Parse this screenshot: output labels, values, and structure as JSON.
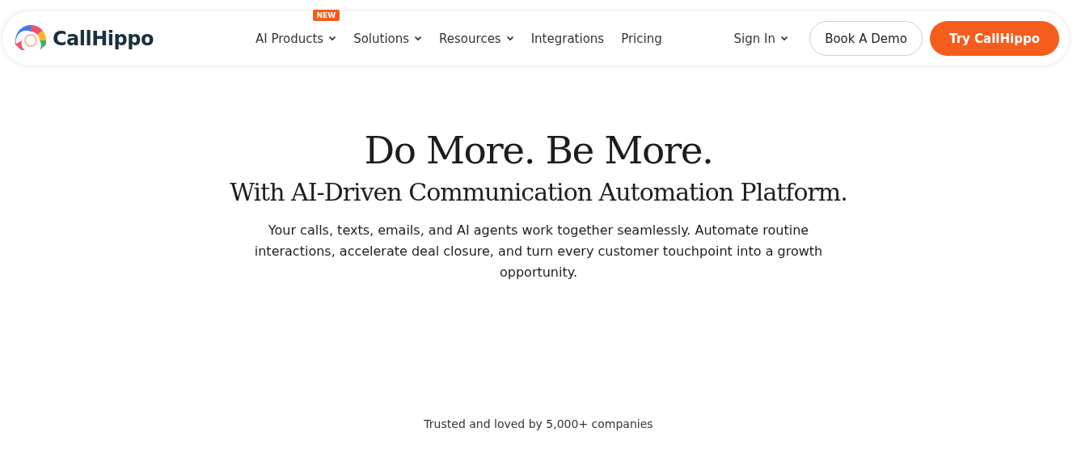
{
  "header": {
    "logo": {
      "text": "CallHippo"
    },
    "nav": [
      {
        "label": "AI Products",
        "kind": "dropdown",
        "badge": "NEW"
      },
      {
        "label": "Solutions",
        "kind": "dropdown"
      },
      {
        "label": "Resources",
        "kind": "dropdown"
      },
      {
        "label": "Integrations",
        "kind": "link"
      },
      {
        "label": "Pricing",
        "kind": "link"
      }
    ],
    "sign_in": {
      "label": "Sign In",
      "kind": "dropdown"
    },
    "buttons": [
      {
        "label": "Book A Demo",
        "kind": "outline"
      },
      {
        "label": "Try CallHippo",
        "kind": "primary"
      }
    ]
  },
  "hero": {
    "title": "Do More. Be More.",
    "subtitle": "With AI-Driven Communication Automation Platform.",
    "description": "Your calls, texts, emails, and AI agents work together seamlessly. Automate routine interactions, accelerate deal closure, and turn every customer touchpoint into a growth opportunity."
  },
  "trusted": "Trusted and loved by 5,000+ companies"
}
